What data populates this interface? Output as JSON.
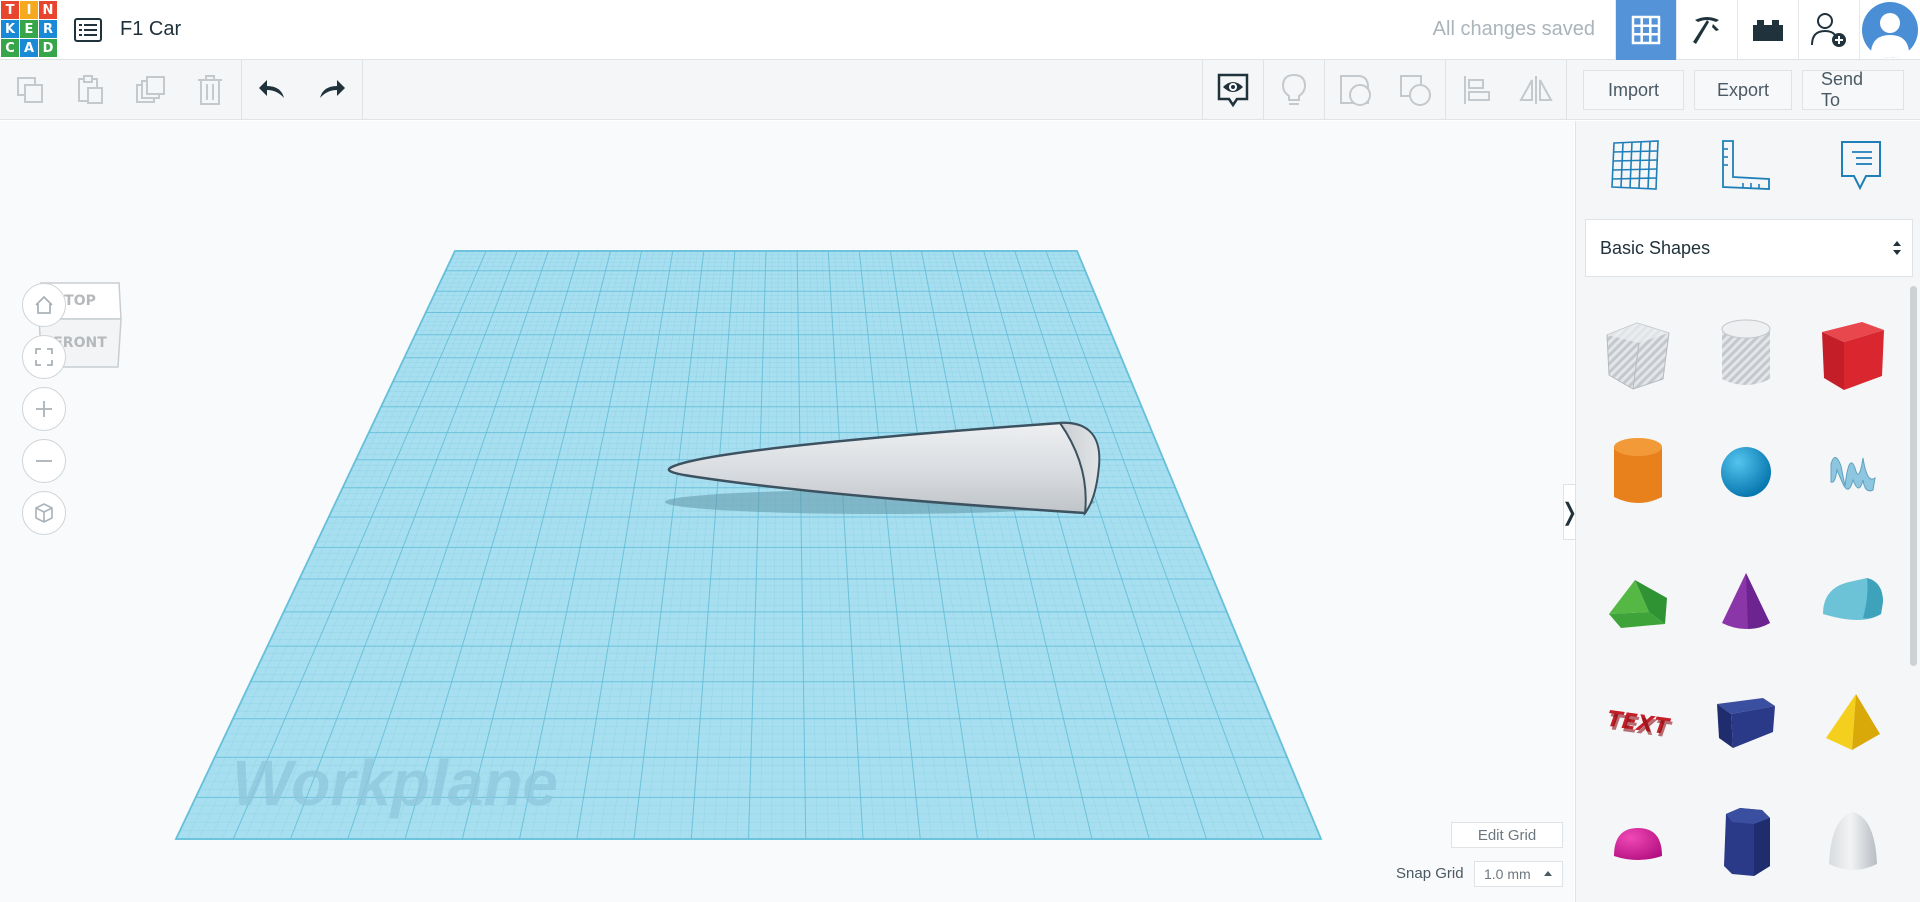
{
  "header": {
    "logo_letters": [
      "T",
      "I",
      "N",
      "K",
      "E",
      "R",
      "C",
      "A",
      "D"
    ],
    "logo_colors": [
      "#e8452f",
      "#f4a91f",
      "#e8452f",
      "#1b8ad6",
      "#37a54a",
      "#1b8ad6",
      "#37a54a",
      "#1b8ad6",
      "#37a54a"
    ],
    "design_title": "F1 Car",
    "save_status": "All changes saved",
    "icons": [
      "3d-design-grid-icon",
      "minecraft-pickaxe-icon",
      "lego-brick-icon",
      "add-user-icon",
      "user-avatar-icon"
    ]
  },
  "toolbar": {
    "left_icons": [
      "copy-icon",
      "paste-icon",
      "duplicate-icon",
      "delete-icon",
      "undo-icon",
      "redo-icon"
    ],
    "right_icons": [
      "show-notes-icon",
      "light-bulb-icon",
      "group-icon",
      "ungroup-icon",
      "align-icon",
      "mirror-icon"
    ],
    "import_label": "Import",
    "export_label": "Export",
    "send_to_label": "Send To"
  },
  "viewcube": {
    "top_label": "TOP",
    "front_label": "FRONT"
  },
  "workplane": {
    "label": "Workplane"
  },
  "grid_controls": {
    "edit_grid_label": "Edit Grid",
    "snap_grid_label": "Snap Grid",
    "snap_grid_value": "1.0 mm"
  },
  "panel": {
    "top_icons": [
      "workplane-grid-icon",
      "ruler-icon",
      "notes-icon"
    ],
    "shapes_category": "Basic Shapes",
    "collapse_glyph": "❭"
  },
  "colors": {
    "accent": "#5493d8",
    "workplane": "#a7dff0",
    "gridline": "#5ab8d4"
  }
}
